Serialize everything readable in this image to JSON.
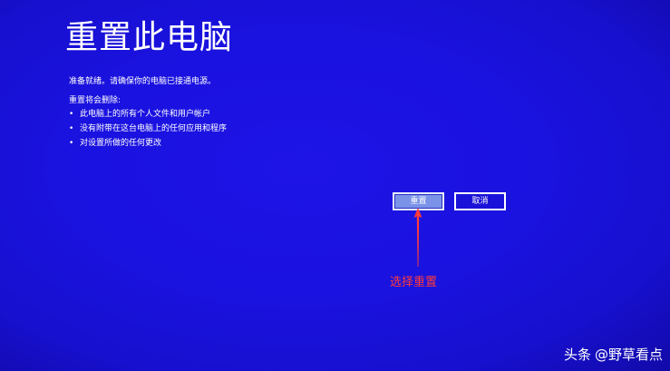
{
  "screen": {
    "title": "重置此电脑",
    "status": "准备就绪。请确保你的电脑已接通电源。",
    "removal_heading": "重置将会删除:",
    "removal_items": [
      "此电脑上的所有个人文件和用户帐户",
      "没有附带在这台电脑上的任何应用和程序",
      "对设置所做的任何更改"
    ],
    "bullet": "•"
  },
  "buttons": {
    "reset_label": "重置",
    "cancel_label": "取消"
  },
  "annotation": {
    "label": "选择重置",
    "color": "#ff3b3b"
  },
  "watermark": {
    "brand": "头条",
    "author": "@野草看点"
  },
  "colors": {
    "background": "#1a12df",
    "text": "#ffffff",
    "primary_button": "#7a92e8"
  }
}
